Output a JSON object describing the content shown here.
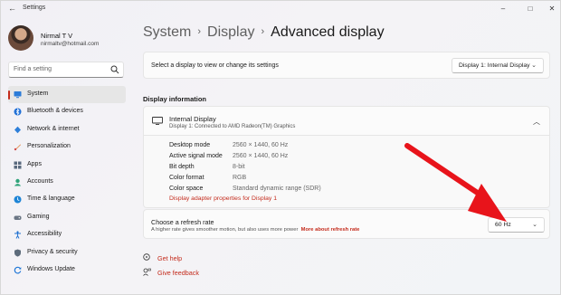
{
  "window": {
    "title": "Settings",
    "controls": {
      "minimize": "–",
      "maximize": "□",
      "close": "✕"
    }
  },
  "user": {
    "name": "Nirmal T V",
    "email": "nirmaltv@hotmail.com"
  },
  "search": {
    "placeholder": "Find a setting"
  },
  "sidebar": {
    "items": [
      {
        "label": "System",
        "icon": "system-icon",
        "selected": true
      },
      {
        "label": "Bluetooth & devices",
        "icon": "bluetooth-icon"
      },
      {
        "label": "Network & internet",
        "icon": "network-icon"
      },
      {
        "label": "Personalization",
        "icon": "personalization-icon"
      },
      {
        "label": "Apps",
        "icon": "apps-icon"
      },
      {
        "label": "Accounts",
        "icon": "accounts-icon"
      },
      {
        "label": "Time & language",
        "icon": "time-language-icon"
      },
      {
        "label": "Gaming",
        "icon": "gaming-icon"
      },
      {
        "label": "Accessibility",
        "icon": "accessibility-icon"
      },
      {
        "label": "Privacy & security",
        "icon": "privacy-icon"
      },
      {
        "label": "Windows Update",
        "icon": "windows-update-icon"
      }
    ]
  },
  "breadcrumb": {
    "level1": "System",
    "level2": "Display",
    "current": "Advanced display"
  },
  "select_display": {
    "label": "Select a display to view or change its settings",
    "value": "Display 1: Internal Display"
  },
  "display_info": {
    "section_title": "Display information",
    "name": "Internal Display",
    "subtitle": "Display 1: Connected to AMD Radeon(TM) Graphics",
    "rows": [
      {
        "label": "Desktop mode",
        "value": "2560 × 1440, 60 Hz"
      },
      {
        "label": "Active signal mode",
        "value": "2560 × 1440, 60 Hz"
      },
      {
        "label": "Bit depth",
        "value": "8-bit"
      },
      {
        "label": "Color format",
        "value": "RGB"
      },
      {
        "label": "Color space",
        "value": "Standard dynamic range (SDR)"
      }
    ],
    "adapter_link": "Display adapter properties for Display 1"
  },
  "refresh_rate": {
    "title": "Choose a refresh rate",
    "description": "A higher rate gives smoother motion, but also uses more power",
    "link": "More about refresh rate",
    "value": "60 Hz"
  },
  "help": {
    "get_help": "Get help",
    "give_feedback": "Give feedback"
  },
  "colors": {
    "accent": "#c42b1c",
    "annotation_arrow": "#e8141b"
  }
}
